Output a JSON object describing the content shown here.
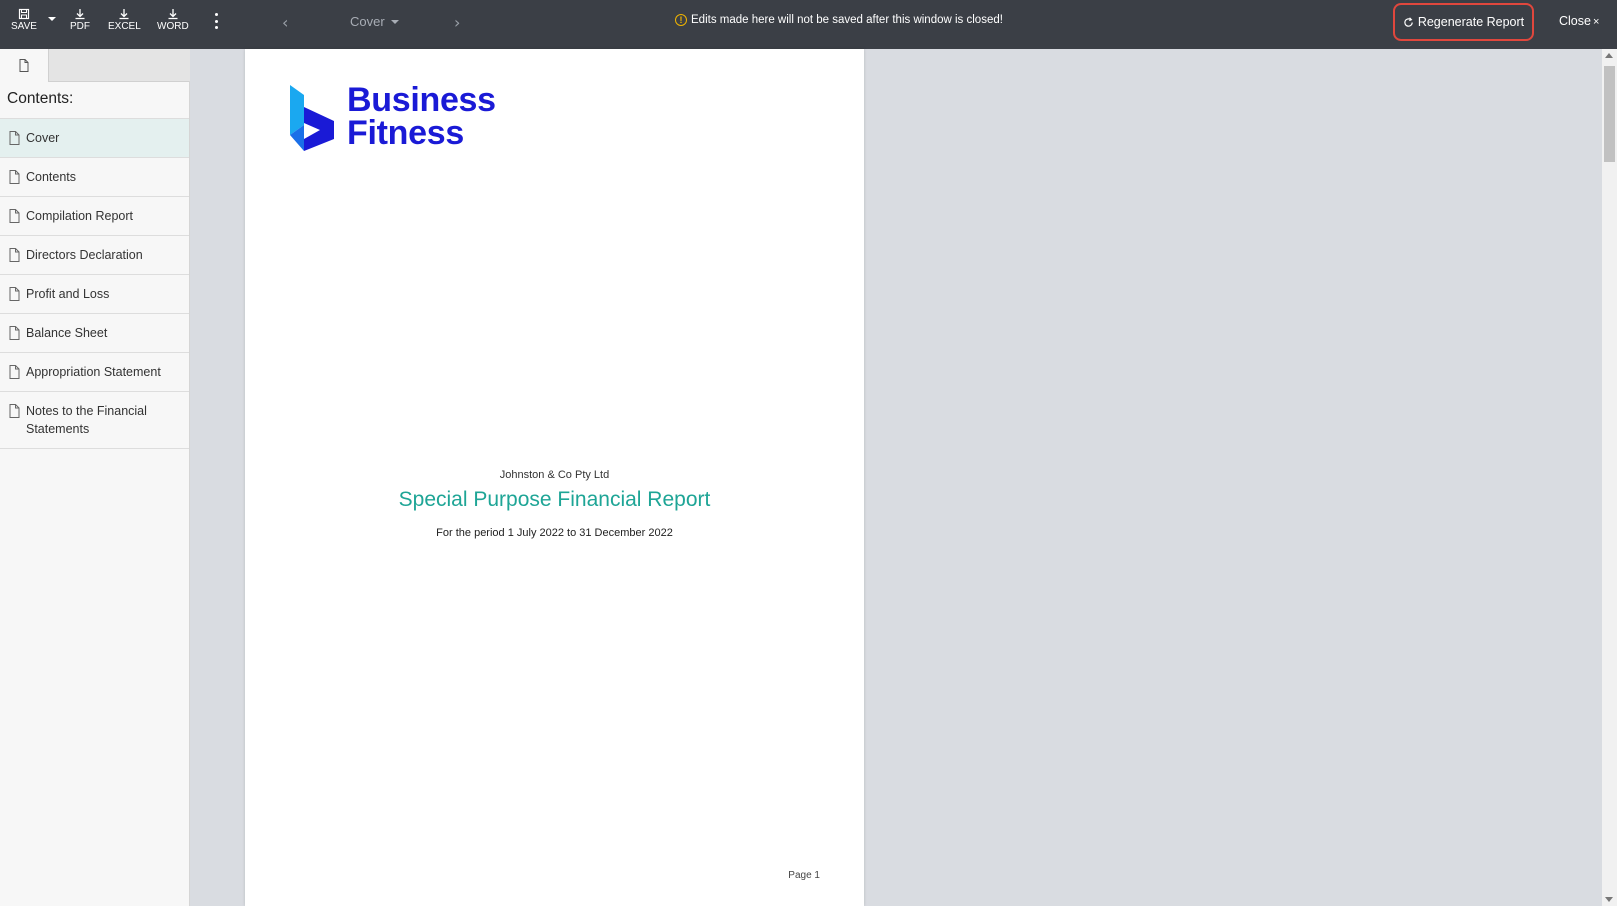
{
  "toolbar": {
    "save_label": "SAVE",
    "pdf_label": "PDF",
    "excel_label": "EXCEL",
    "word_label": "WORD",
    "section_selected": "Cover",
    "warning_text": "Edits made here will not be saved after this window is closed!",
    "regenerate_label": "Regenerate Report",
    "close_label": "Close",
    "close_symbol": "×",
    "accent_color": "#e0473d"
  },
  "sidebar": {
    "heading": "Contents:",
    "items": [
      {
        "label": "Cover",
        "active": true
      },
      {
        "label": "Contents"
      },
      {
        "label": "Compilation Report"
      },
      {
        "label": "Directors Declaration"
      },
      {
        "label": "Profit and Loss"
      },
      {
        "label": "Balance Sheet"
      },
      {
        "label": "Appropriation Statement"
      },
      {
        "label": "Notes to the Financial Statements"
      }
    ]
  },
  "document": {
    "logo_line1": "Business",
    "logo_line2": "Fitness",
    "company": "Johnston & Co Pty Ltd",
    "title": "Special Purpose Financial Report",
    "period": "For the period 1 July 2022 to 31 December 2022",
    "page_label": "Page 1",
    "title_color": "#1ea596",
    "logo_color": "#1a1ad6"
  }
}
